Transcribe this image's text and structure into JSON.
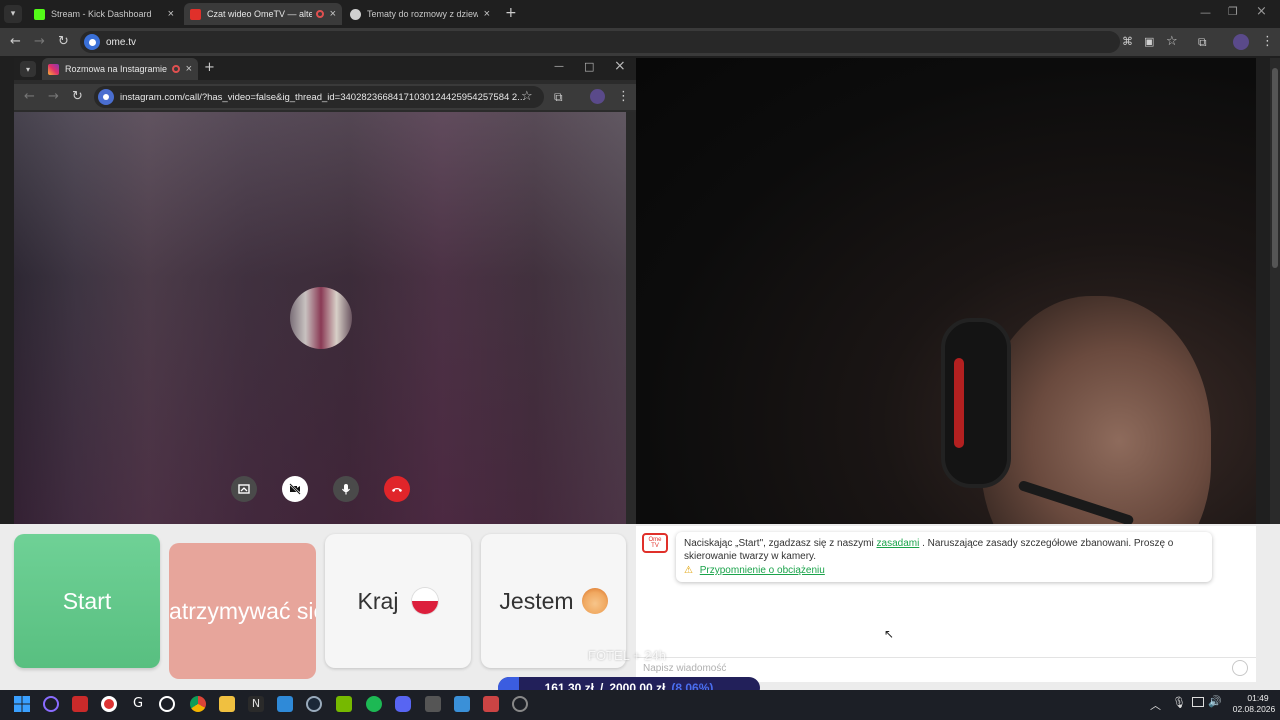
{
  "browser": {
    "tabs": [
      {
        "title": "Stream - Kick Dashboard",
        "favicon_color": "#53fc18"
      },
      {
        "title": "Czat wideo OmeTV — alter",
        "favicon_color": "#e0302a"
      },
      {
        "title": "Tematy do rozmowy z dziewczy",
        "favicon_color": "#cfcfcf"
      }
    ],
    "new_tab_symbol": "+",
    "url": "ome.tv"
  },
  "instagram_window": {
    "tab_title": "Rozmowa na Instagramie",
    "url": "instagram.com/call/?has_video=false&ig_thread_id=34028236684171030124425954257584 2...",
    "controls": [
      "share-screen-icon",
      "camera-off-icon",
      "microphone-icon",
      "hang-up-icon"
    ]
  },
  "ome": {
    "buttons": {
      "start": "Start",
      "stop": "Zatrzymywać się",
      "country": "Kraj",
      "gender": "Jestem"
    },
    "logo_text": "Ome TV",
    "notice_prefix": "Naciskając „Start\", zgadzasz się z naszymi",
    "notice_link": "zasadami",
    "notice_suffix": ". Naruszające zasady szczegółowe zbanowani. Proszę o skierowanie twarzy w kamery.",
    "reminder_link": "Przypomnienie o obciążeniu",
    "message_placeholder": "Napisz wiadomość"
  },
  "overlay": {
    "fotel": "FOTEL + 24h",
    "goal_current": "161,30 zł",
    "goal_separator": "/",
    "goal_target": "2000,00 zł",
    "goal_percent": "(8.06%)",
    "goal_progress": 0.0806
  },
  "taskbar": {
    "time": "01:49",
    "date": "02.08.2026"
  },
  "colors": {
    "start_green": "#66c98a",
    "stop_red": "#e7a59b",
    "accent_green": "#1aa34a",
    "hangup_red": "#e0252a"
  }
}
